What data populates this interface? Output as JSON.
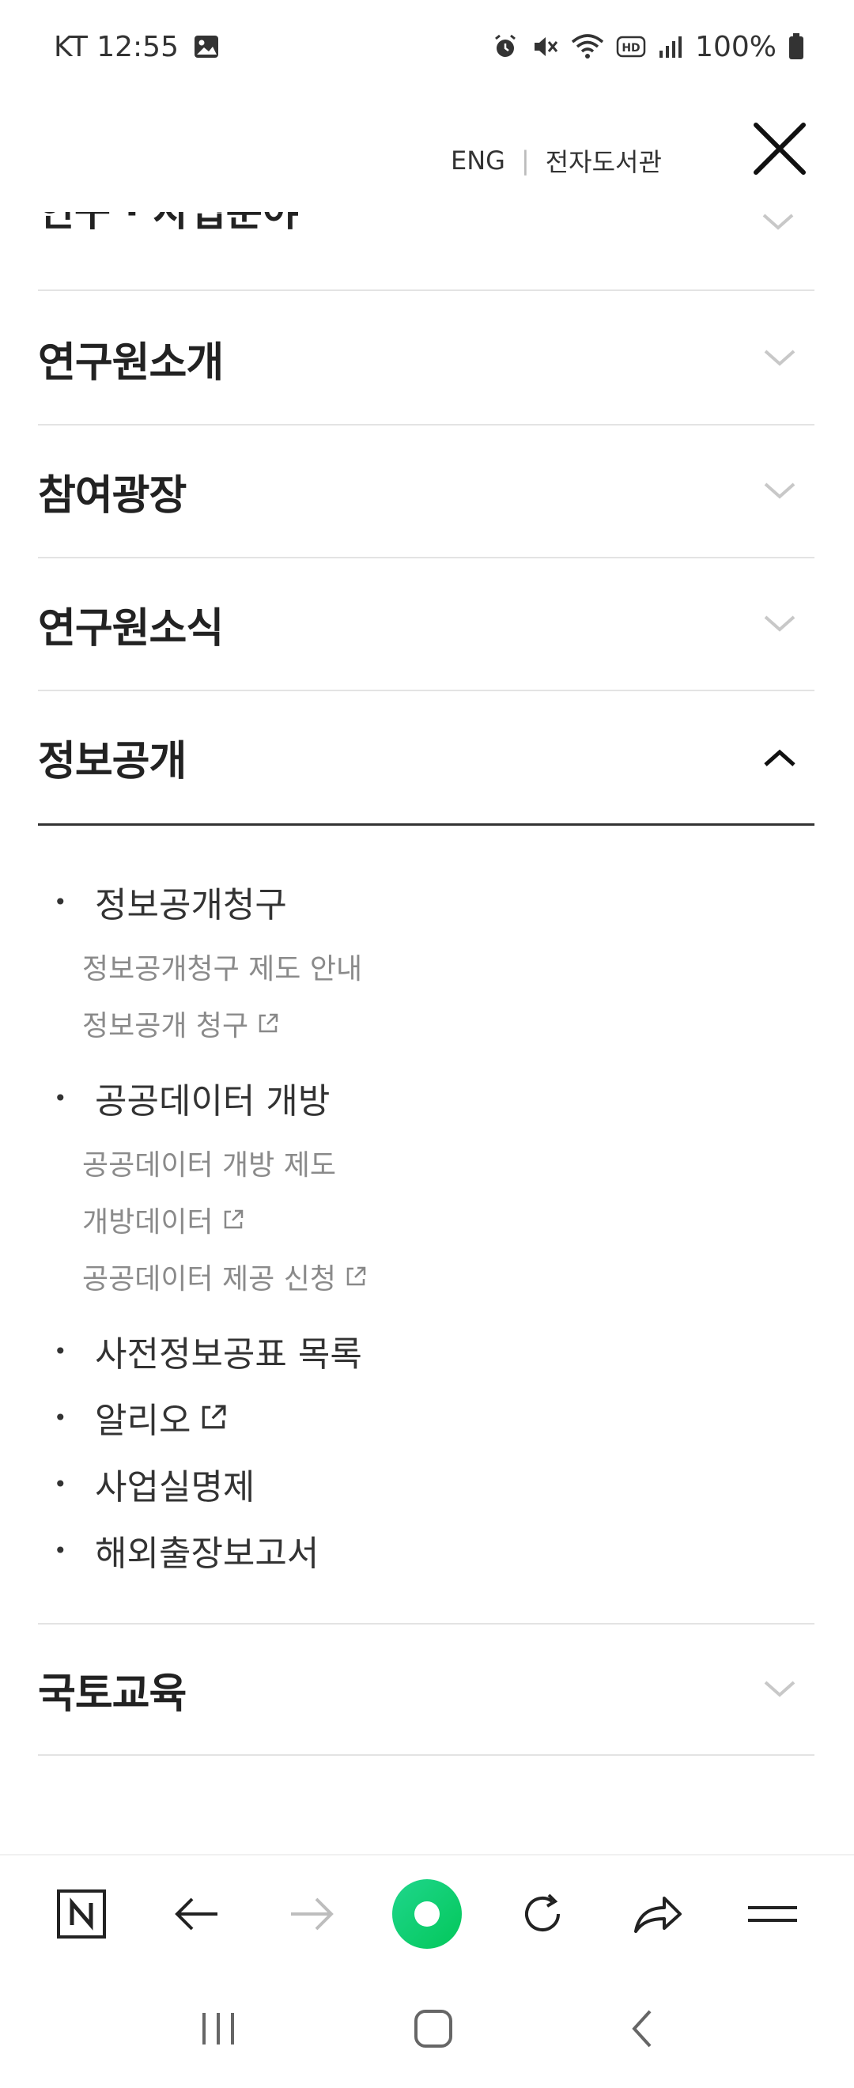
{
  "status_bar": {
    "carrier_time": "KT 12:55",
    "battery": "100%",
    "icons": [
      "image-icon",
      "alarm-icon",
      "mute-icon",
      "wifi-icon",
      "hd-icon",
      "signal-icon",
      "battery-icon"
    ]
  },
  "header": {
    "eng": "ENG",
    "separator": "|",
    "library": "전자도서관"
  },
  "menu": {
    "partial_label": "연구 · 사업분야",
    "items": [
      {
        "label": "연구원소개"
      },
      {
        "label": "참여광장"
      },
      {
        "label": "연구원소식"
      },
      {
        "label": "정보공개"
      },
      {
        "label": "국토교육"
      }
    ]
  },
  "submenu": {
    "group1": {
      "title": "정보공개청구",
      "children": [
        "정보공개청구 제도 안내",
        "정보공개 청구"
      ]
    },
    "group2": {
      "title": "공공데이터 개방",
      "children": [
        "공공데이터 개방 제도",
        "개방데이터",
        "공공데이터 제공 신청"
      ]
    },
    "item3": "사전정보공표 목록",
    "item4": "알리오",
    "item5": "사업실명제",
    "item6": "해외출장보고서"
  },
  "colors": {
    "accent_green": "#03c75a",
    "divider": "#e3e3e3",
    "sub_text": "#8a8a8a"
  }
}
